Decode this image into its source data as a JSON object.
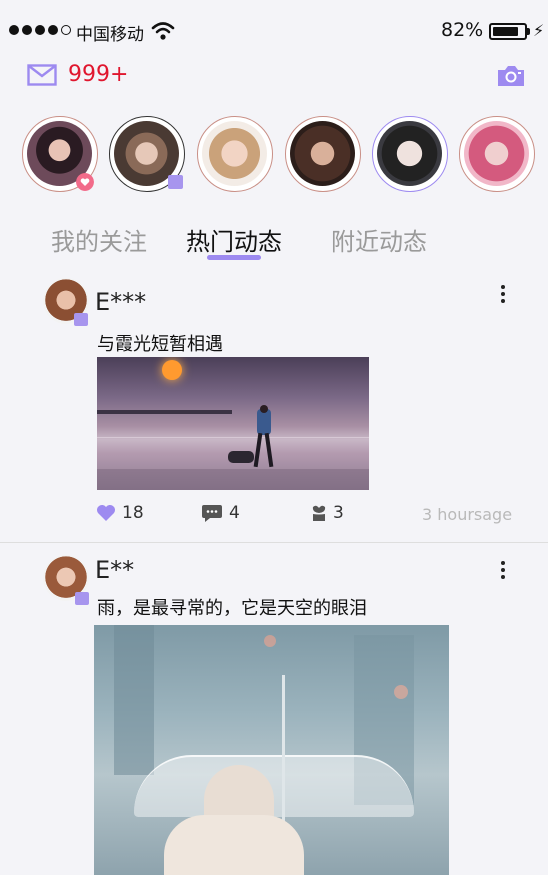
{
  "status_bar": {
    "carrier": "中国移动",
    "battery_percent": "82%",
    "signal_bars_filled": 4,
    "signal_bars_total": 5,
    "battery_level": 0.82
  },
  "header": {
    "mail_count": "999+",
    "accent_color": "#9d8af0"
  },
  "stories": [
    {
      "name": "story-1",
      "badge": "heart-icon"
    },
    {
      "name": "story-2",
      "badge": "verified-icon"
    },
    {
      "name": "story-3"
    },
    {
      "name": "story-4"
    },
    {
      "name": "story-5"
    },
    {
      "name": "story-6"
    }
  ],
  "tabs": [
    {
      "label": "我的关注",
      "active": false
    },
    {
      "label": "热门动态",
      "active": true
    },
    {
      "label": "附近动态",
      "active": false
    }
  ],
  "posts": [
    {
      "username": "E***",
      "caption": "与霞光短暂相遇",
      "likes": "18",
      "comments": "4",
      "gifts": "3",
      "time": "3 hoursage"
    },
    {
      "username": "E**",
      "caption": "雨，是最寻常的，它是天空的眼泪"
    }
  ]
}
